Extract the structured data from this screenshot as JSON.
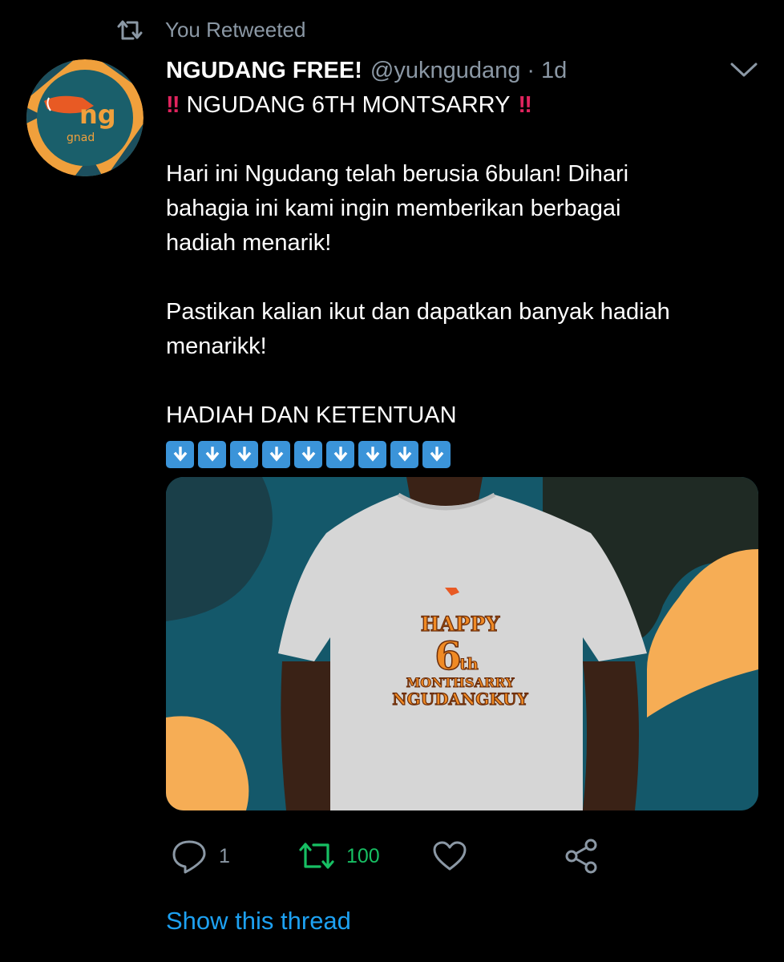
{
  "retweet_context": {
    "label": "You Retweeted"
  },
  "tweet": {
    "author": {
      "name": "NGUDANG FREE!",
      "handle": "@yukngudang",
      "separator": "·",
      "time": "1d"
    },
    "title_emoji": "‼",
    "title": "NGUDANG 6TH MONTSARRY",
    "paragraphs": [
      "Hari ini Ngudang telah berusia 6bulan! Dihari\nbahagia ini kami ingin memberikan berbagai\nhadiah menarik!",
      "Pastikan kalian ikut dan dapatkan banyak hadiah\nmenarikk!",
      "HADIAH DAN KETENTUAN"
    ],
    "arrow_emoji_count": 9,
    "arrow_emoji_icon": "down-arrow-key-icon",
    "media": {
      "shirt_text": {
        "line1": "HAPPY",
        "number": "6",
        "suffix": "th",
        "line3": "MONTHSARRY",
        "line4": "NGUDANGKUY"
      },
      "colors": {
        "background": "#14586a",
        "blob_orange": "#f6ad55",
        "blob_dark": "#1f2a24",
        "shirt": "#d6d6d6"
      }
    },
    "actions": {
      "reply_count": "1",
      "retweet_count": "100",
      "retweet_active": true
    },
    "show_thread": "Show this thread"
  },
  "colors": {
    "background": "#000000",
    "muted": "#8b98a5",
    "link": "#1da1f2",
    "retweet_green": "#17bf63",
    "emoji_red": "#e0245e",
    "arrow_key_blue": "#3b94d9"
  }
}
